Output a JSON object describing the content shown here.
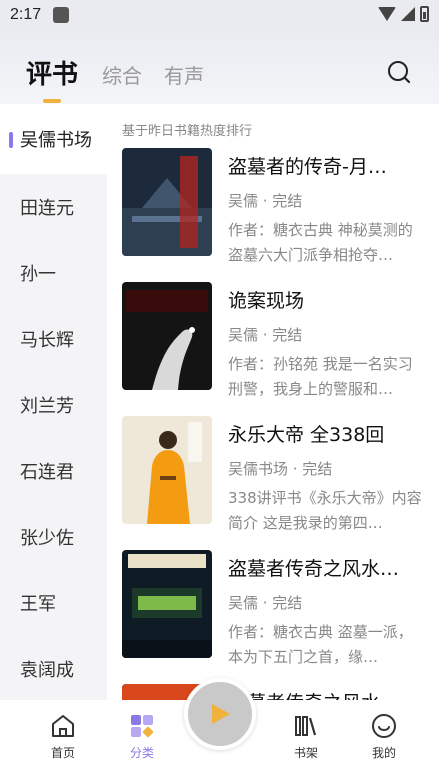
{
  "status_bar": {
    "time": "2:17"
  },
  "header": {
    "tabs": [
      {
        "label": "评书"
      },
      {
        "label": "综合"
      },
      {
        "label": "有声"
      }
    ]
  },
  "sidebar": {
    "items": [
      {
        "label": "吴儒书场"
      },
      {
        "label": "田连元"
      },
      {
        "label": "孙一"
      },
      {
        "label": "马长辉"
      },
      {
        "label": "刘兰芳"
      },
      {
        "label": "石连君"
      },
      {
        "label": "张少佐"
      },
      {
        "label": "王军"
      },
      {
        "label": "袁阔成"
      }
    ]
  },
  "list": {
    "caption": "基于昨日书籍热度排行",
    "books": [
      {
        "title": "盗墓者的传奇-月…",
        "meta": "吴儒 · 完结",
        "desc": "作者：糖衣古典 神秘莫测的盗墓六大门派争相抢夺…",
        "cover_colors": [
          "#1c2a3c",
          "#c0392b"
        ]
      },
      {
        "title": "诡案现场",
        "meta": "吴儒 · 完结",
        "desc": "作者：孙铭苑 我是一名实习刑警，我身上的警服和…",
        "cover_colors": [
          "#141414",
          "#c62828"
        ]
      },
      {
        "title": "永乐大帝 全338回",
        "meta": "吴儒书场 · 完结",
        "desc": "338讲评书《永乐大帝》内容简介 这是我录的第四…",
        "cover_colors": [
          "#efe7d8",
          "#f5a623"
        ]
      },
      {
        "title": "盗墓者传奇之风水…",
        "meta": "吴儒 · 完结",
        "desc": "作者：糖衣古典 盗墓一派，本为下五门之首，缘…",
        "cover_colors": [
          "#0e1a24",
          "#8fd14f"
        ]
      },
      {
        "title": "盗墓者传奇之风水",
        "meta": "",
        "desc": "",
        "cover_colors": [
          "#2a0d08",
          "#d9481c"
        ]
      }
    ]
  },
  "bottom_nav": {
    "items": [
      {
        "label": "首页"
      },
      {
        "label": "分类"
      },
      {
        "label": "书架"
      },
      {
        "label": "我的"
      }
    ],
    "accent": "#8c78e6"
  }
}
